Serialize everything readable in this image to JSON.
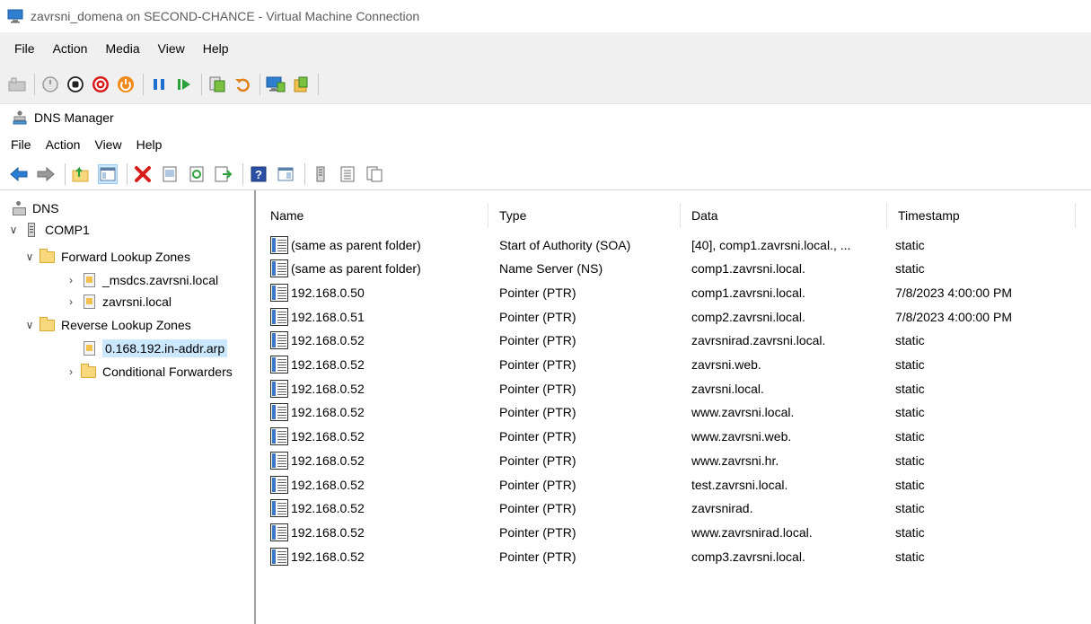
{
  "vm": {
    "title": "zavrsni_domena on SECOND-CHANCE - Virtual Machine Connection",
    "menu": [
      "File",
      "Action",
      "Media",
      "View",
      "Help"
    ],
    "toolbar_icons": [
      "ctrl-alt-del-icon",
      "start-icon",
      "turn-off-icon",
      "shutdown-icon",
      "power-icon",
      "pause-icon",
      "resume-icon",
      "checkpoint-icon",
      "revert-icon",
      "enhanced-session-icon",
      "share-icon"
    ]
  },
  "dns": {
    "title": "DNS Manager",
    "menu": [
      "File",
      "Action",
      "View",
      "Help"
    ],
    "toolbar_icons": [
      "back-arrow-icon",
      "forward-arrow-icon",
      "up-folder-icon",
      "show-hide-tree-icon",
      "delete-icon",
      "properties-icon",
      "refresh-icon",
      "export-list-icon",
      "help-icon",
      "console-tree-icon",
      "server-icon",
      "list-icon",
      "copy-icon"
    ]
  },
  "tree": {
    "root": "DNS",
    "server": "COMP1",
    "forward_zones": "Forward Lookup Zones",
    "msdcs": "_msdcs.zavrsni.local",
    "zavrsni_local": "zavrsni.local",
    "reverse_zones": "Reverse Lookup Zones",
    "reverse_zone": "0.168.192.in-addr.arp",
    "conditional": "Conditional Forwarders"
  },
  "columns": [
    "Name",
    "Type",
    "Data",
    "Timestamp"
  ],
  "records": [
    {
      "name": "(same as parent folder)",
      "type": "Start of Authority (SOA)",
      "data": "[40], comp1.zavrsni.local., ...",
      "timestamp": "static"
    },
    {
      "name": "(same as parent folder)",
      "type": "Name Server (NS)",
      "data": "comp1.zavrsni.local.",
      "timestamp": "static"
    },
    {
      "name": "192.168.0.50",
      "type": "Pointer (PTR)",
      "data": "comp1.zavrsni.local.",
      "timestamp": "7/8/2023 4:00:00 PM"
    },
    {
      "name": "192.168.0.51",
      "type": "Pointer (PTR)",
      "data": "comp2.zavrsni.local.",
      "timestamp": "7/8/2023 4:00:00 PM"
    },
    {
      "name": "192.168.0.52",
      "type": "Pointer (PTR)",
      "data": "zavrsnirad.zavrsni.local.",
      "timestamp": "static"
    },
    {
      "name": "192.168.0.52",
      "type": "Pointer (PTR)",
      "data": "zavrsni.web.",
      "timestamp": "static"
    },
    {
      "name": "192.168.0.52",
      "type": "Pointer (PTR)",
      "data": "zavrsni.local.",
      "timestamp": "static"
    },
    {
      "name": "192.168.0.52",
      "type": "Pointer (PTR)",
      "data": "www.zavrsni.local.",
      "timestamp": "static"
    },
    {
      "name": "192.168.0.52",
      "type": "Pointer (PTR)",
      "data": "www.zavrsni.web.",
      "timestamp": "static"
    },
    {
      "name": "192.168.0.52",
      "type": "Pointer (PTR)",
      "data": "www.zavrsni.hr.",
      "timestamp": "static"
    },
    {
      "name": "192.168.0.52",
      "type": "Pointer (PTR)",
      "data": "test.zavrsni.local.",
      "timestamp": "static"
    },
    {
      "name": "192.168.0.52",
      "type": "Pointer (PTR)",
      "data": "zavrsnirad.",
      "timestamp": "static"
    },
    {
      "name": "192.168.0.52",
      "type": "Pointer (PTR)",
      "data": "www.zavrsnirad.local.",
      "timestamp": "static"
    },
    {
      "name": "192.168.0.52",
      "type": "Pointer (PTR)",
      "data": "comp3.zavrsni.local.",
      "timestamp": "static"
    }
  ]
}
